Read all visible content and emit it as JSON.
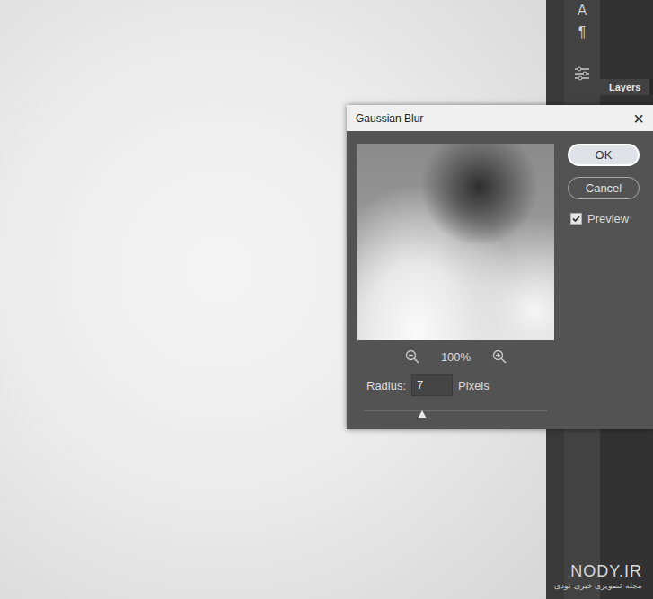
{
  "canvas": {
    "watermark": "NODY.IR",
    "watermark_caption": "مجله تصویری خبری نودی"
  },
  "toolbar": {
    "icons": [
      "A",
      "¶"
    ]
  },
  "panels": {
    "tabs": [
      {
        "label": "Layers",
        "selected": true
      }
    ]
  },
  "dialog": {
    "title": "Gaussian Blur",
    "close": "×",
    "zoom": "100%",
    "radius": {
      "label": "Radius:",
      "value": "7",
      "unit": "Pixels"
    },
    "slider": {
      "level": 0.32
    },
    "buttons": [
      {
        "label": "OK",
        "selected": true
      },
      {
        "label": "Cancel",
        "selected": false
      }
    ],
    "preview": {
      "label": "Preview",
      "checked": true
    }
  }
}
